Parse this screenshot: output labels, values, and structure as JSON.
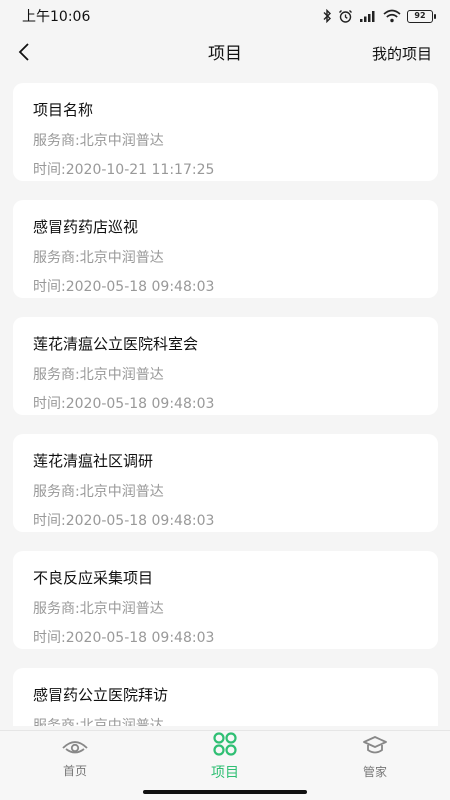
{
  "status_bar": {
    "time": "上午10:06",
    "battery": "92"
  },
  "nav": {
    "title": "项目",
    "right_action": "我的项目",
    "back_icon": "chevron-left-icon"
  },
  "projects": [
    {
      "title": "项目名称",
      "provider": "服务商:北京中润普达",
      "time": "时间:2020-10-21 11:17:25"
    },
    {
      "title": "感冒药药店巡视",
      "provider": "服务商:北京中润普达",
      "time": "时间:2020-05-18 09:48:03"
    },
    {
      "title": "莲花清瘟公立医院科室会",
      "provider": "服务商:北京中润普达",
      "time": "时间:2020-05-18 09:48:03"
    },
    {
      "title": "莲花清瘟社区调研",
      "provider": "服务商:北京中润普达",
      "time": "时间:2020-05-18 09:48:03"
    },
    {
      "title": "不良反应采集项目",
      "provider": "服务商:北京中润普达",
      "time": "时间:2020-05-18 09:48:03"
    },
    {
      "title": "感冒药公立医院拜访",
      "provider": "服务商:北京中润普达",
      "time": ""
    }
  ],
  "tabs": [
    {
      "label": "首页",
      "icon": "eye-home-icon",
      "active": false
    },
    {
      "label": "项目",
      "icon": "four-circles-icon",
      "active": true
    },
    {
      "label": "管家",
      "icon": "butler-hat-icon",
      "active": false
    }
  ],
  "colors": {
    "accent": "#2fbf73",
    "background": "#f5f5f5",
    "card": "#ffffff",
    "secondary_text": "#999999"
  }
}
